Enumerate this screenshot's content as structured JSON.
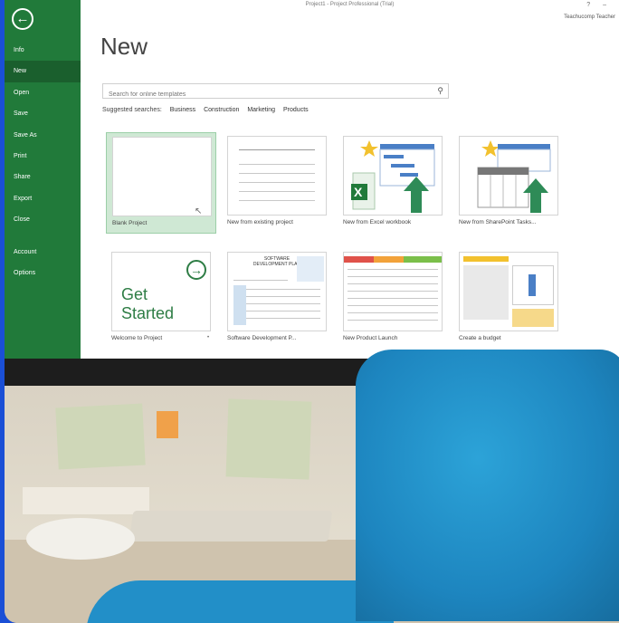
{
  "window": {
    "title": "Project1 - Project Professional (Trial)",
    "user": "Teachucomp Teacher",
    "controls": "?  –"
  },
  "sidebar": {
    "back_icon": "back-arrow-icon",
    "items": [
      {
        "label": "Info"
      },
      {
        "label": "New",
        "active": true
      },
      {
        "label": "Open"
      },
      {
        "label": "Save"
      },
      {
        "label": "Save As"
      },
      {
        "label": "Print"
      },
      {
        "label": "Share"
      },
      {
        "label": "Export"
      },
      {
        "label": "Close"
      },
      {
        "label": "Account"
      },
      {
        "label": "Options"
      }
    ]
  },
  "main": {
    "title": "New",
    "search": {
      "placeholder": "Search for online templates",
      "value": ""
    },
    "suggested_label": "Suggested searches:",
    "suggested": [
      "Business",
      "Construction",
      "Marketing",
      "Products"
    ],
    "templates": [
      {
        "label": "Blank Project"
      },
      {
        "label": "New from existing project"
      },
      {
        "label": "New from Excel workbook"
      },
      {
        "label": "New from SharePoint Tasks..."
      },
      {
        "label": "Welcome to Project",
        "thumb_text": "Get Started",
        "pin": "✕"
      },
      {
        "label": "Software Development P...",
        "thumb_text": "SOFTWARE DEVELOPMENT PLAN"
      },
      {
        "label": "New Product Launch"
      },
      {
        "label": "Create a budget"
      }
    ]
  },
  "colors": {
    "accent_green": "#217a3a",
    "selected_tile": "#cfe8d4",
    "page_border_blue": "#1a4fd6",
    "chair_blue": "#1d85bf"
  }
}
